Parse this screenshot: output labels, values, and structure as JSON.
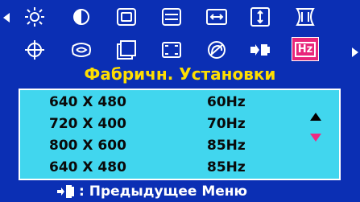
{
  "menu": {
    "icons_row1": [
      "brightness-icon",
      "contrast-icon",
      "h-size-icon",
      "v-size-icon",
      "h-position-icon",
      "v-position-icon",
      "pincushion-icon"
    ],
    "icons_row2": [
      "geometry-icon",
      "trapezoid-icon",
      "parallelogram-icon",
      "zoom-icon",
      "degauss-icon",
      "input-icon",
      "frequency-icon"
    ],
    "selected_icon_label": "Hz",
    "title": "Фабричн. Установки"
  },
  "modes": [
    {
      "resolution": "640 X 480",
      "frequency": "60Hz"
    },
    {
      "resolution": "720 X 400",
      "frequency": "70Hz"
    },
    {
      "resolution": "800 X 600",
      "frequency": "85Hz"
    },
    {
      "resolution": "640 X 480",
      "frequency": "85Hz"
    }
  ],
  "footer": {
    "label": ": Предыдущее Меню"
  },
  "colors": {
    "background": "#0b2fb4",
    "title": "#ffde00",
    "panel": "#41d6ee",
    "selected": "#e8267a"
  }
}
